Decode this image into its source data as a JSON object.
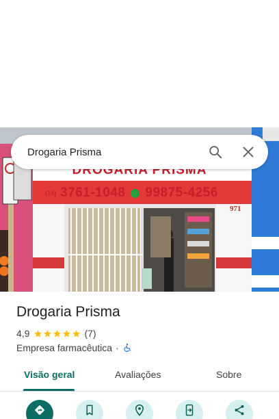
{
  "search": {
    "query": "Drogaria Prisma"
  },
  "photo": {
    "sign_name": "DROGARIA PRISMA",
    "sign_area_code": "(14)",
    "sign_phone_1": "3761-1048",
    "sign_phone_2": "99875-4256",
    "door_number": "971"
  },
  "place": {
    "name": "Drogaria Prisma",
    "rating": "4,9",
    "stars": 5,
    "review_count": "(7)",
    "category": "Empresa farmacêutica",
    "separator": "·"
  },
  "tabs": [
    {
      "label": "Visão geral"
    },
    {
      "label": "Avaliações"
    },
    {
      "label": "Sobre"
    }
  ],
  "actions": {
    "icons": [
      "directions-icon",
      "save-icon",
      "nearby-icon",
      "send-to-phone-icon",
      "share-icon"
    ]
  },
  "colors": {
    "accent": "#0b6e64",
    "accent_light": "#d6f0ef",
    "star": "#fbbc04",
    "sign_red": "#c7202e"
  }
}
